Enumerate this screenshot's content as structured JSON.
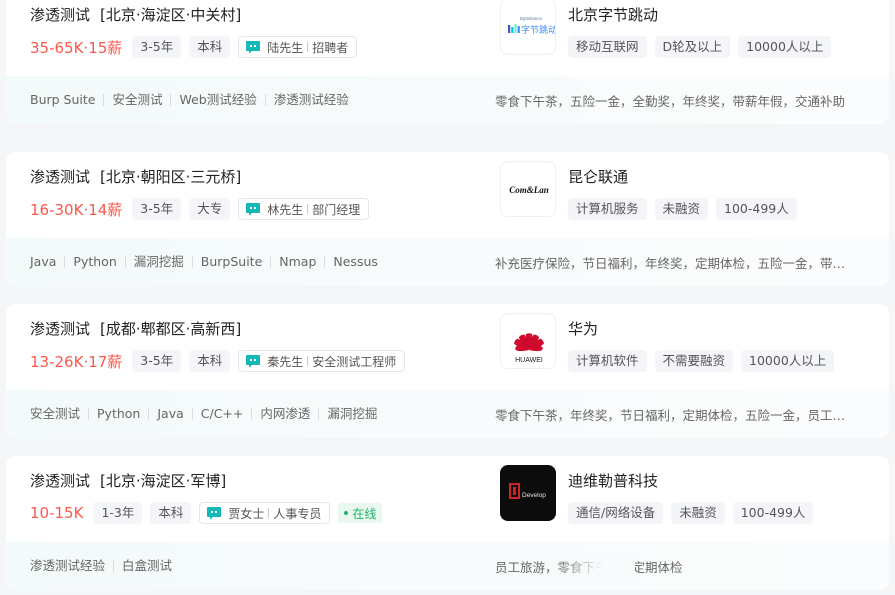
{
  "jobs": [
    {
      "title": "渗透测试",
      "area": "[北京·海淀区·中关村]",
      "salary": "35-65K·15薪",
      "experience": "3-5年",
      "degree": "本科",
      "recruiter_name": "陆先生",
      "recruiter_role": "招聘者",
      "company": "北京字节跳动",
      "company_tags": [
        "移动互联网",
        "D轮及以上",
        "10000人以上"
      ],
      "skills": [
        "Burp Suite",
        "安全测试",
        "Web测试经验",
        "渗透测试经验"
      ],
      "welfare": "零食下午茶，五险一金，全勤奖，年终奖，带薪年假，交通补助",
      "logo": {
        "type": "bytedance",
        "small_text": "ByteDance",
        "main_text": "字节跳动",
        "color": "#3c8cff"
      }
    },
    {
      "title": "渗透测试",
      "area": "[北京·朝阳区·三元桥]",
      "salary": "16-30K·14薪",
      "experience": "3-5年",
      "degree": "大专",
      "recruiter_name": "林先生",
      "recruiter_role": "部门经理",
      "company": "昆仑联通",
      "company_tags": [
        "计算机服务",
        "未融资",
        "100-499人"
      ],
      "skills": [
        "Java",
        "Python",
        "漏洞挖掘",
        "BurpSuite",
        "Nmap",
        "Nessus"
      ],
      "welfare": "补充医疗保险，节日福利，年终奖，定期体检，五险一金，带薪年假",
      "logo": {
        "type": "text",
        "main_text": "Com&Lan",
        "color": "#111111"
      }
    },
    {
      "title": "渗透测试",
      "area": "[成都·郫都区·高新西]",
      "salary": "13-26K·17薪",
      "experience": "3-5年",
      "degree": "本科",
      "recruiter_name": "秦先生",
      "recruiter_role": "安全测试工程师",
      "company": "华为",
      "company_tags": [
        "计算机软件",
        "不需要融资",
        "10000人以上"
      ],
      "skills": [
        "安全测试",
        "Python",
        "Java",
        "C/C++",
        "内网渗透",
        "漏洞挖掘"
      ],
      "welfare": "零食下午茶，年终奖，节日福利，定期体检，五险一金，员工旅游",
      "logo": {
        "type": "huawei",
        "main_text": "HUAWEI",
        "color": "#cf0a2c"
      }
    },
    {
      "title": "渗透测试",
      "area": "[北京·海淀区·军博]",
      "salary": "10-15K",
      "experience": "1-3年",
      "degree": "本科",
      "recruiter_name": "贾女士",
      "recruiter_role": "人事专员",
      "online": "在线",
      "company": "迪维勒普科技",
      "company_tags": [
        "通信/网络设备",
        "未融资",
        "100-499人"
      ],
      "skills": [
        "渗透测试经验",
        "白盒测试"
      ],
      "welfare": "员工旅游，零食下午茶，定期体检",
      "logo": {
        "type": "develop",
        "main_text": "Develop",
        "color": "#0c0c0c"
      }
    }
  ],
  "colors": {
    "salary": "#fe574a",
    "chat_icon": "#14b8b8",
    "online": "#24b36b"
  }
}
